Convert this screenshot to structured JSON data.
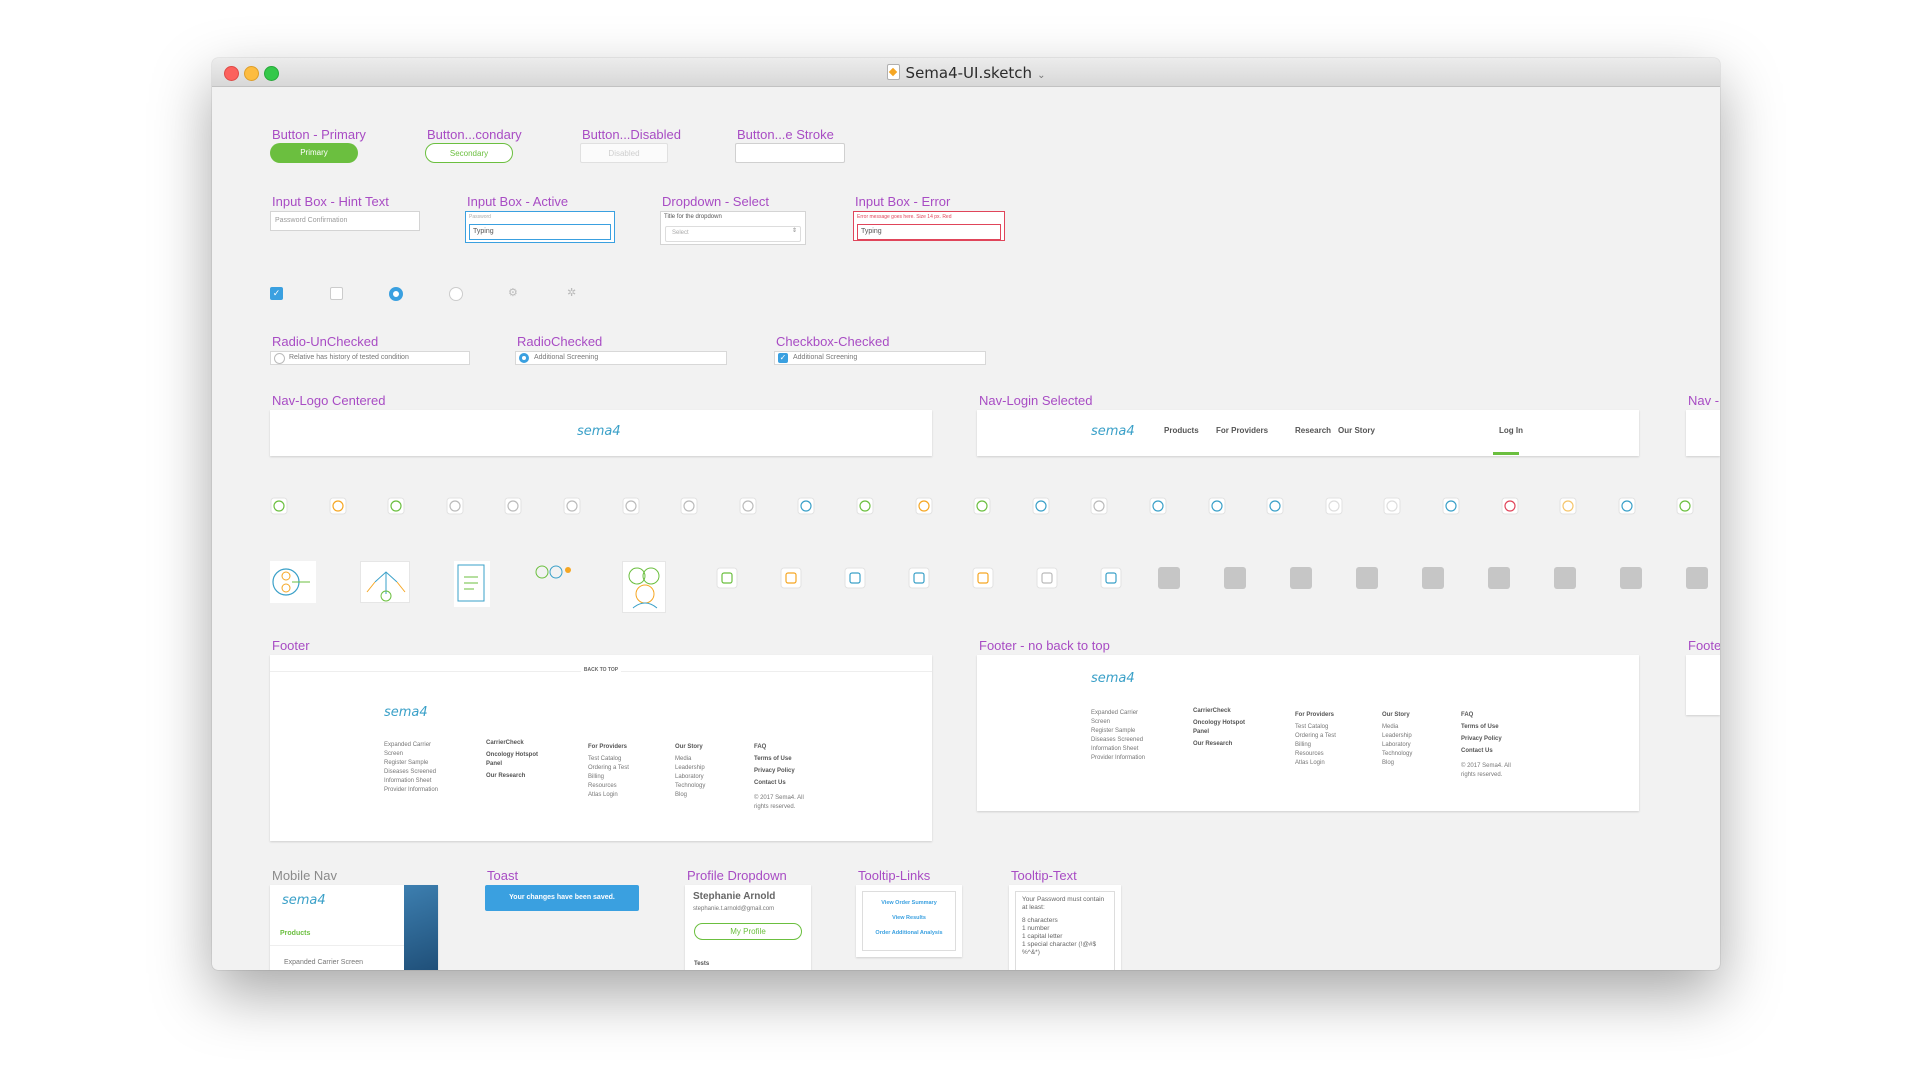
{
  "window": {
    "title": "Sema4-UI.sketch"
  },
  "colors": {
    "accent_purple": "#a84cc4",
    "primary_green": "#6bbf3f",
    "link_blue": "#3aa0e0",
    "error_red": "#e0455a",
    "logo_blue": "#3aa0c8"
  },
  "buttons": {
    "primary_label": "Button - Primary",
    "primary_text": "Primary",
    "secondary_label": "Button...condary",
    "secondary_text": "Secondary",
    "disabled_label": "Button...Disabled",
    "disabled_text": "Disabled",
    "stroke_label": "Button...e Stroke"
  },
  "inputs": {
    "hint_label": "Input Box - Hint Text",
    "hint_placeholder": "Password Confirmation",
    "active_label": "Input Box - Active",
    "active_small": "Password",
    "active_value": "Typing",
    "dropdown_label": "Dropdown - Select",
    "dropdown_title": "Title for the dropdown",
    "dropdown_value": "Select",
    "error_label": "Input Box - Error",
    "error_message": "Error message goes here. Size 14 px. Red",
    "error_value": "Typing"
  },
  "choices": {
    "radio_unchecked_label": "Radio-UnChecked",
    "radio_unchecked_text": "Relative has history of tested condition",
    "radio_checked_label": "RadioChecked",
    "radio_checked_text": "Additional Screening",
    "checkbox_checked_label": "Checkbox-Checked",
    "checkbox_checked_text": "Additional Screening"
  },
  "nav": {
    "centered_label": "Nav-Logo Centered",
    "login_label": "Nav-Login Selected",
    "cut_label": "Nav - wi",
    "logo": "sema4",
    "items": [
      "Products",
      "For Providers",
      "Research",
      "Our Story"
    ],
    "login": "Log In"
  },
  "footer": {
    "label": "Footer",
    "no_top_label": "Footer - no back to top",
    "cut_label": "Footer -",
    "back_to_top": "BACK TO TOP",
    "logo": "sema4",
    "col1": [
      "Expanded Carrier Screen",
      "Register Sample",
      "Diseases Screened",
      "Information Sheet",
      "Provider Information"
    ],
    "col2_head": "CarrierCheck",
    "col2": [
      "Oncology Hotspot Panel",
      "Our Research"
    ],
    "col3_head": "For Providers",
    "col3": [
      "Test Catalog",
      "Ordering a Test",
      "Billing",
      "Resources",
      "Atlas Login"
    ],
    "col4_head": "Our Story",
    "col4": [
      "Media",
      "Leadership",
      "Laboratory",
      "Technology",
      "Blog"
    ],
    "col5_head": "FAQ",
    "col5": [
      "Terms of Use",
      "Privacy Policy",
      "Contact Us"
    ],
    "copyright": "© 2017 Sema4. All rights reserved."
  },
  "bottom": {
    "mobile_label": "Mobile Nav",
    "mobile_logo": "sema4",
    "mobile_products": "Products",
    "mobile_item": "Expanded Carrier Screen",
    "toast_label": "Toast",
    "toast_text": "Your changes have been saved.",
    "profile_label": "Profile Dropdown",
    "profile_name": "Stephanie Arnold",
    "profile_email": "stephanie.t.arnold@gmail.com",
    "profile_button": "My Profile",
    "profile_tests": "Tests",
    "tooltip_links_label": "Tooltip-Links",
    "tooltip_links": [
      "View Order Summary",
      "View Results",
      "Order Additional Analysis"
    ],
    "tooltip_text_label": "Tooltip-Text",
    "tooltip_text_intro": "Your Password must contain at least:",
    "tooltip_text_items": [
      "8 characters",
      "1 number",
      "1 capital letter",
      "1 special character (!@#$ %^&*)"
    ]
  },
  "icons": {
    "row1": [
      "check-circle-icon",
      "plus-circle-icon",
      "minus-circle-icon",
      "x-circle-icon",
      "info-circle-icon",
      "alert-circle-icon",
      "clipboard-icon",
      "document-icon",
      "calendar-icon",
      "drop-icon",
      "flask-icon",
      "pin-icon",
      "home-icon",
      "search-icon",
      "camera-icon",
      "plus-icon",
      "tube-icon",
      "user-icon",
      "blank-icon",
      "blank-icon",
      "add-circle-icon",
      "location-icon",
      "mail-icon",
      "zoom-icon",
      "chat-icon"
    ],
    "row2_large": [
      "dna-flow-icon",
      "arrows-up-icon",
      "report-doc-icon",
      "molecule-icon",
      "family-icon"
    ],
    "row2_small": [
      "tree-icon",
      "key-icon",
      "document-blue-icon",
      "pencil-icon",
      "key-icon",
      "list-circle-icon",
      "share-circle-icon"
    ],
    "row2_gray": [
      "doc-gray-icon",
      "pen-gray-icon",
      "user-gray-icon",
      "list-gray-icon",
      "mail-gray-icon",
      "menu-gray-icon",
      "check-gray-icon",
      "share-gray-icon",
      "refresh-gray-icon"
    ]
  }
}
